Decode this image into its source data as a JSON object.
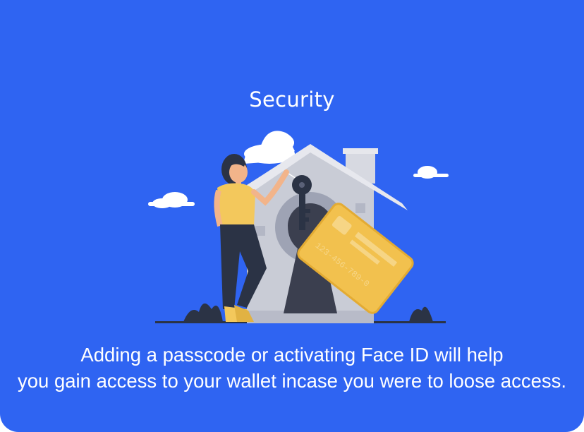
{
  "screen": {
    "title": "Security",
    "description_lines": [
      "Adding a passcode or activating Face ID will help",
      "you gain access to your wallet incase you were to loose access."
    ]
  },
  "illustration": {
    "card_number": "123-456-789-0",
    "icons": [
      "house-icon",
      "keyhole-icon",
      "key-icon",
      "credit-card-icon",
      "person-icon",
      "cloud-icon"
    ]
  },
  "colors": {
    "background": "#2f64f2",
    "card_gold": "#f2c14e",
    "house_gray": "#c9ccd6",
    "keyhole_dark": "#3b3f4f"
  }
}
